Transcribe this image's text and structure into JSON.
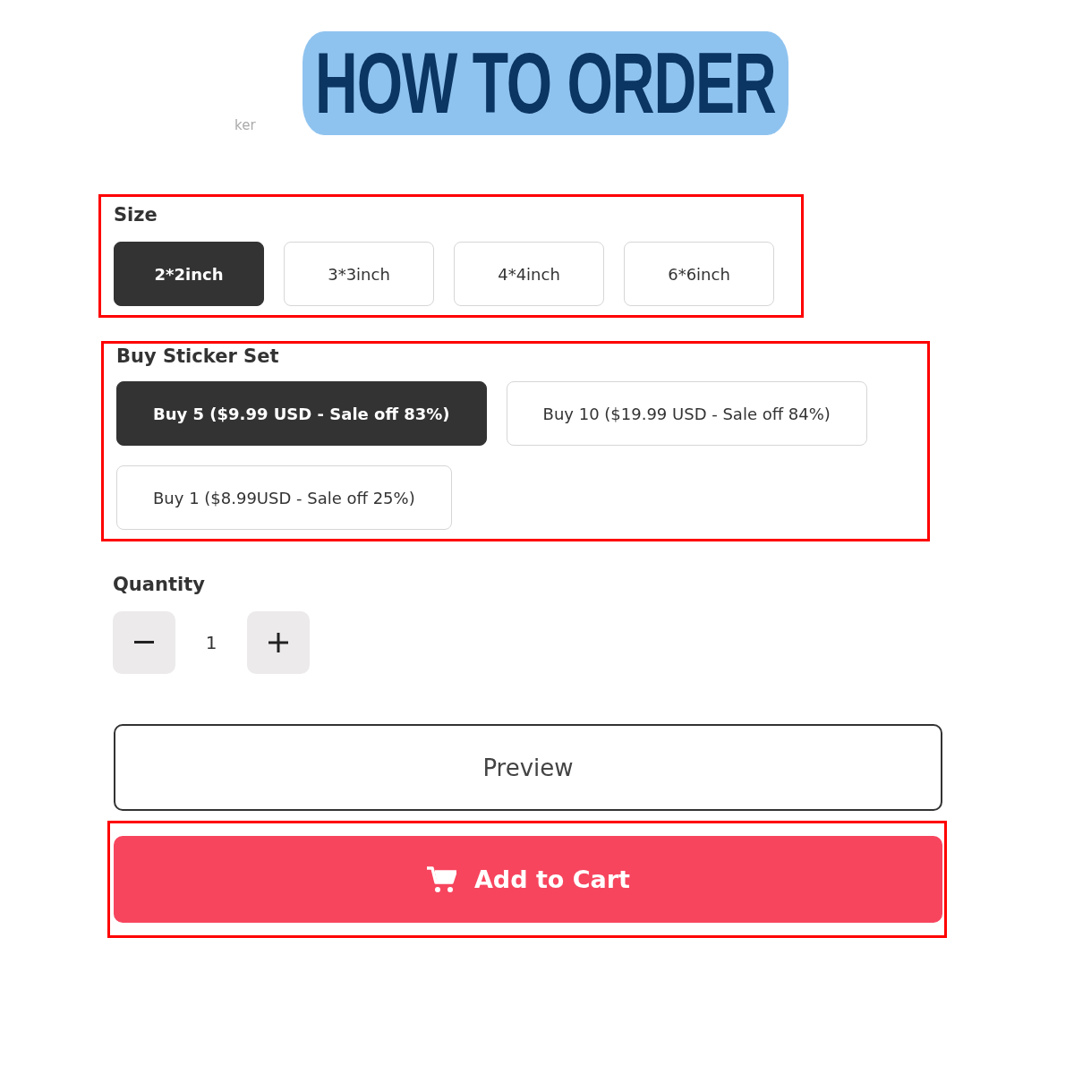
{
  "title": "HOW TO ORDER",
  "faint_text": "ker",
  "size": {
    "label": "Size",
    "annotated": true,
    "options": [
      {
        "label": "2*2inch",
        "selected": true
      },
      {
        "label": "3*3inch",
        "selected": false
      },
      {
        "label": "4*4inch",
        "selected": false
      },
      {
        "label": "6*6inch",
        "selected": false
      }
    ]
  },
  "sticker_set": {
    "label": "Buy Sticker Set",
    "annotated": true,
    "options": [
      {
        "label": "Buy 5 ($9.99 USD - Sale off 83%)",
        "selected": true
      },
      {
        "label": "Buy 10 ($19.99 USD - Sale off 84%)",
        "selected": false
      },
      {
        "label": "Buy 1 ($8.99USD - Sale off 25%)",
        "selected": false
      }
    ]
  },
  "quantity": {
    "label": "Quantity",
    "value": "1"
  },
  "preview_button": {
    "label": "Preview"
  },
  "add_to_cart_button": {
    "label": "Add to Cart",
    "annotated": true
  }
}
